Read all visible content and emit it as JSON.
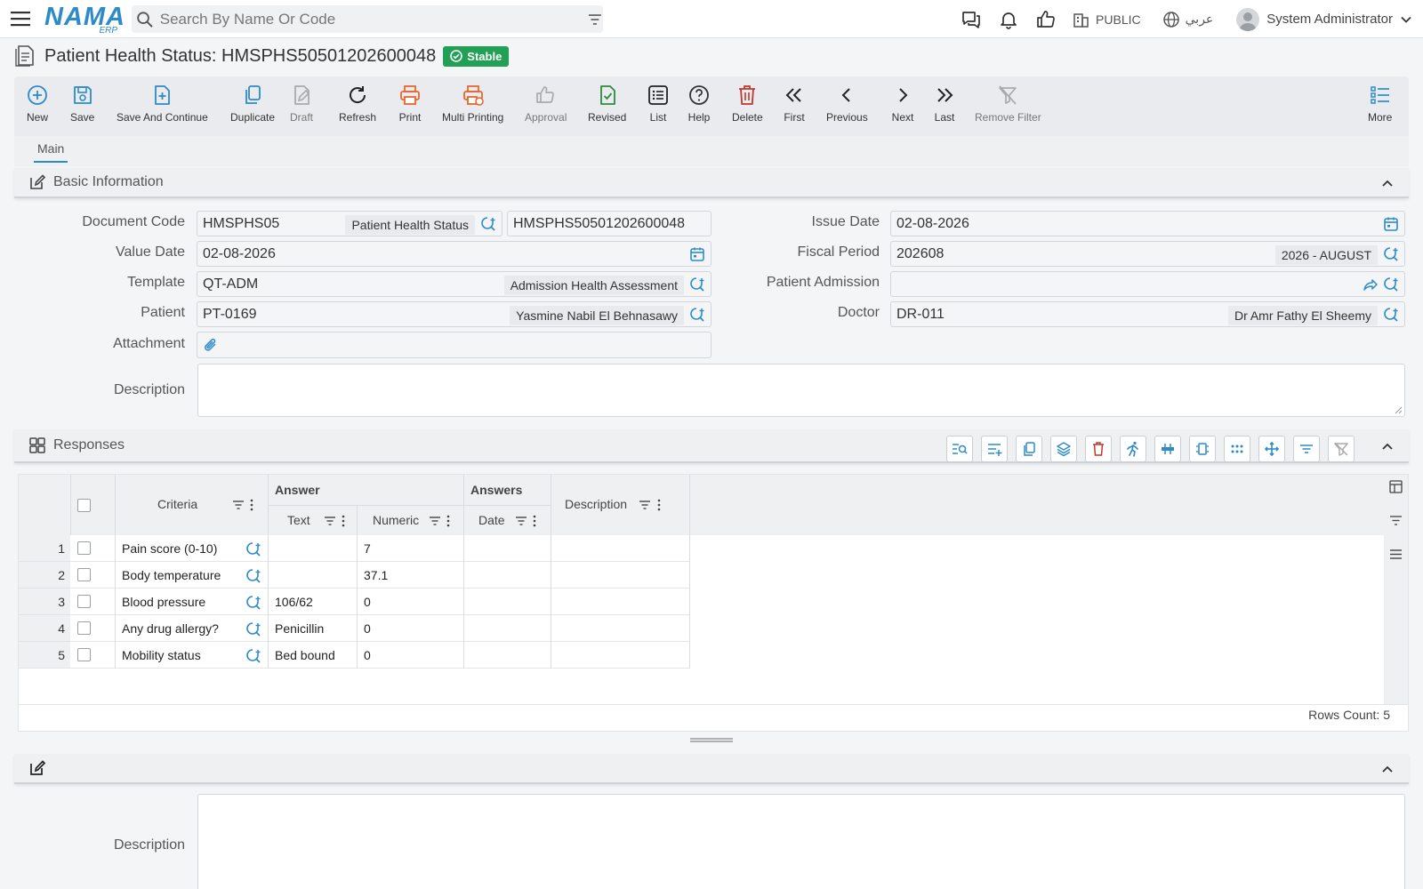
{
  "topbar": {
    "search_placeholder": "Search By Name Or Code",
    "branch": "PUBLIC",
    "language": "عربي",
    "user_name": "System Administrator",
    "logo_text": "NAMA",
    "logo_sub": "ERP"
  },
  "page": {
    "title": "Patient Health Status: HMSPHS50501202600048",
    "status_badge": "Stable"
  },
  "toolbar": {
    "new": "New",
    "save": "Save",
    "save_continue": "Save And Continue",
    "duplicate": "Duplicate",
    "draft": "Draft",
    "refresh": "Refresh",
    "print": "Print",
    "multi_printing": "Multi Printing",
    "approval": "Approval",
    "revised": "Revised",
    "list": "List",
    "help": "Help",
    "delete": "Delete",
    "first": "First",
    "previous": "Previous",
    "next": "Next",
    "last": "Last",
    "remove_filter": "Remove Filter",
    "more": "More"
  },
  "tabs": {
    "main": "Main"
  },
  "basic_info": {
    "section_title": "Basic Information",
    "document_code": {
      "label": "Document Code",
      "code": "HMSPHS05",
      "name": "Patient Health Status",
      "number": "HMSPHS50501202600048"
    },
    "issue_date": {
      "label": "Issue Date",
      "value": "02-08-2026"
    },
    "value_date": {
      "label": "Value Date",
      "value": "02-08-2026"
    },
    "fiscal_period": {
      "label": "Fiscal Period",
      "value": "202608",
      "name": "2026 - AUGUST"
    },
    "template": {
      "label": "Template",
      "value": "QT-ADM",
      "name": "Admission Health Assessment"
    },
    "patient_admission": {
      "label": "Patient Admission",
      "value": ""
    },
    "patient": {
      "label": "Patient",
      "value": "PT-0169",
      "name": "Yasmine Nabil El Behnasawy"
    },
    "doctor": {
      "label": "Doctor",
      "value": "DR-011",
      "name": "Dr Amr Fathy El Sheemy"
    },
    "attachment": {
      "label": "Attachment"
    },
    "description": {
      "label": "Description",
      "value": ""
    }
  },
  "responses": {
    "section_title": "Responses",
    "columns": {
      "criteria": "Criteria",
      "answer_group": "Answer",
      "answers_group": "Answers",
      "text": "Text",
      "numeric": "Numeric",
      "date": "Date",
      "description": "Description"
    },
    "rows": [
      {
        "num": "1",
        "criteria": "Pain score (0-10)",
        "text": "",
        "numeric": "7",
        "date": "",
        "description": ""
      },
      {
        "num": "2",
        "criteria": "Body temperature",
        "text": "",
        "numeric": "37.1",
        "date": "",
        "description": ""
      },
      {
        "num": "3",
        "criteria": "Blood pressure",
        "text": "106/62",
        "numeric": "0",
        "date": "",
        "description": ""
      },
      {
        "num": "4",
        "criteria": "Any drug allergy?",
        "text": "Penicillin",
        "numeric": "0",
        "date": "",
        "description": ""
      },
      {
        "num": "5",
        "criteria": "Mobility status",
        "text": "Bed bound",
        "numeric": "0",
        "date": "",
        "description": ""
      }
    ],
    "rows_count": "Rows Count: 5"
  },
  "bottom_section": {
    "description_label": "Description",
    "description_value": ""
  },
  "colors": {
    "accent": "#2e8bc9",
    "stable": "#21a056",
    "print": "#e8672a",
    "delete": "#c0392b",
    "revised": "#2e8b3e"
  }
}
